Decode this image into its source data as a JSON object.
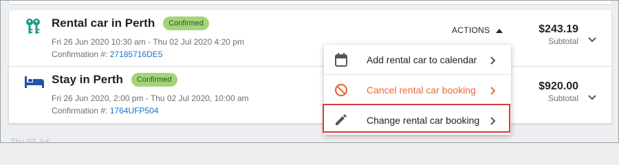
{
  "bookings": [
    {
      "icon": "car-keys-icon",
      "title": "Rental car in Perth",
      "status": "Confirmed",
      "dates": "Fri 26 Jun 2020 10:30 am - Thu 02 Jul 2020 4:20 pm",
      "confirmation_label": "Confirmation #:",
      "confirmation_number": "27185716DE5",
      "actions_label": "ACTIONS",
      "price": "$243.19",
      "price_label": "Subtotal"
    },
    {
      "icon": "bed-icon",
      "title": "Stay in Perth",
      "status": "Confirmed",
      "dates": "Fri 26 Jun 2020, 2:00 pm - Thu 02 Jul 2020, 10:00 am",
      "confirmation_label": "Confirmation #:",
      "confirmation_number": "1764UFP504",
      "price": "$920.00",
      "price_label": "Subtotal"
    }
  ],
  "actions_menu": {
    "items": [
      {
        "label": "Add rental car to calendar",
        "icon": "calendar-icon",
        "color": "#212121"
      },
      {
        "label": "Cancel rental car booking",
        "icon": "cancel-icon",
        "color": "#e8693a"
      },
      {
        "label": "Change rental car booking",
        "icon": "pencil-icon",
        "color": "#212121",
        "highlighted": true
      }
    ]
  },
  "next_day_header": "Thu 02 Jul",
  "colors": {
    "accent_icon": "#1b9e8c",
    "stay_icon": "#2450a8",
    "badge_bg": "#a5d37a",
    "link": "#1a73c8",
    "cancel": "#e8693a",
    "highlight_border": "#d73a3a"
  }
}
